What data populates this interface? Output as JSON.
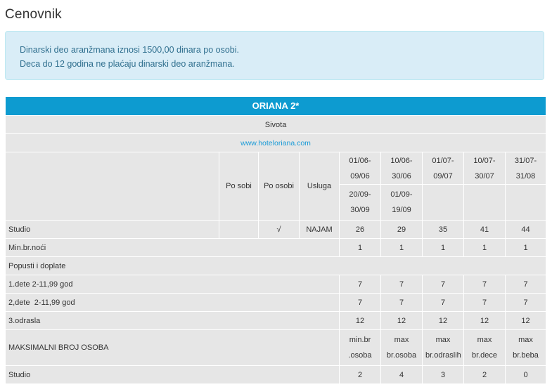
{
  "page": {
    "title": "Cenovnik"
  },
  "info": {
    "line1": "Dinarski deo aranžmana iznosi 1500,00 dinara po osobi.",
    "line2": "Deca do 12 godina ne plaćaju dinarski deo aranžmana."
  },
  "hotel": {
    "name": "ORIANA 2*",
    "location": "Sivota",
    "website": "www.hoteloriana.com"
  },
  "table": {
    "headers": {
      "po_sobi": "Po sobi",
      "po_osobi": "Po osobi",
      "usluga": "Usluga"
    },
    "periods_row1": [
      [
        "01/06-",
        "09/06"
      ],
      [
        "10/06-",
        "30/06"
      ],
      [
        "01/07-",
        "09/07"
      ],
      [
        "10/07-",
        "30/07"
      ],
      [
        "31/07-",
        "31/08"
      ]
    ],
    "periods_row2": [
      [
        "20/09-",
        "30/09"
      ],
      [
        "01/09-",
        "19/09"
      ],
      [
        "",
        ""
      ],
      [
        "",
        ""
      ],
      [
        "",
        ""
      ]
    ],
    "studio": {
      "label": "Studio",
      "po_sobi": "",
      "po_osobi": "√",
      "usluga": "NAJAM",
      "prices": [
        "26",
        "29",
        "35",
        "41",
        "44"
      ]
    },
    "min_nights": {
      "label": "Min.br.noći",
      "values": [
        "1",
        "1",
        "1",
        "1",
        "1"
      ]
    },
    "discounts_label": "Popusti i doplate",
    "child1": {
      "label": "1.dete 2-11,99 god",
      "values": [
        "7",
        "7",
        "7",
        "7",
        "7"
      ]
    },
    "child2": {
      "label": "2,dete  2-11,99 god",
      "values": [
        "7",
        "7",
        "7",
        "7",
        "7"
      ]
    },
    "adult3": {
      "label": "3.odrasla",
      "values": [
        "12",
        "12",
        "12",
        "12",
        "12"
      ]
    },
    "max_persons": {
      "label": "MAKSIMALNI BROJ OSOBA",
      "columns": [
        [
          "min.br",
          ".osoba"
        ],
        [
          "max",
          "br.osoba"
        ],
        [
          "max",
          "br.odraslih"
        ],
        [
          "max",
          "br.dece"
        ],
        [
          "max",
          "br.beba"
        ]
      ]
    },
    "studio_capacity": {
      "label": "Studio",
      "values": [
        "2",
        "4",
        "3",
        "2",
        "0"
      ]
    }
  }
}
